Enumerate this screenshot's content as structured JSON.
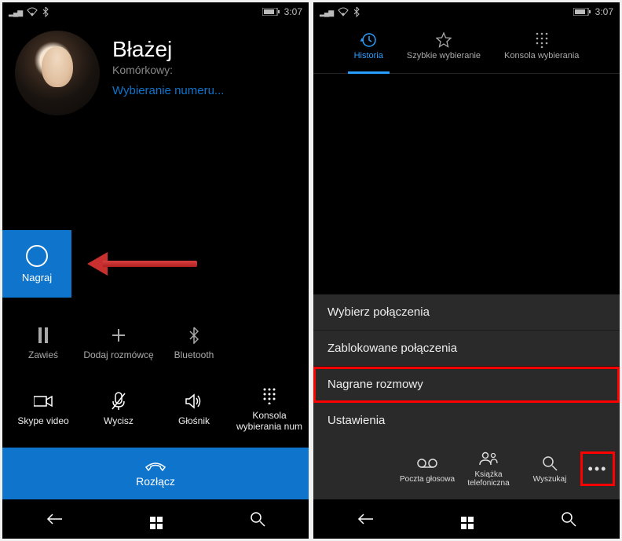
{
  "status": {
    "time": "3:07"
  },
  "call": {
    "name": "Błażej",
    "type": "Komórkowy:",
    "status": "Wybieranie numeru...",
    "record_label": "Nagraj",
    "actions_row1": [
      {
        "label": "Zawieś"
      },
      {
        "label": "Dodaj rozmówcę"
      },
      {
        "label": "Bluetooth"
      }
    ],
    "actions_row2": [
      {
        "label": "Skype video"
      },
      {
        "label": "Wycisz"
      },
      {
        "label": "Głośnik"
      },
      {
        "label": "Konsola wybierania num"
      }
    ],
    "hangup": "Rozłącz"
  },
  "phoneapp": {
    "tabs": [
      {
        "label": "Historia"
      },
      {
        "label": "Szybkie wybieranie"
      },
      {
        "label": "Konsola wybierania"
      }
    ],
    "menu": [
      "Wybierz połączenia",
      "Zablokowane połączenia",
      "Nagrane rozmowy",
      "Ustawienia"
    ],
    "bottom": [
      {
        "label": "Poczta głosowa"
      },
      {
        "label": "Książka telefoniczna"
      },
      {
        "label": "Wyszukaj"
      }
    ]
  }
}
